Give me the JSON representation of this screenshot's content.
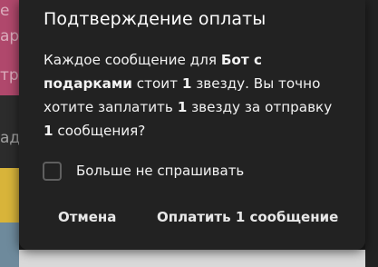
{
  "background": {
    "fragments": [
      "е",
      "ар",
      "тр",
      "аде"
    ],
    "colors": {
      "tile_pink": "#b0486c",
      "tile_yellow": "#d8b43a",
      "tile_dark": "#2c2c2c"
    }
  },
  "dialog": {
    "title": "Подтверждение оплаты",
    "body": {
      "part1": "Каждое сообщение для ",
      "bot_name": "Бот с подарками",
      "part2": " стоит ",
      "cost_amount": "1",
      "part3": " звезду. Вы точно хотите заплатить ",
      "pay_amount": "1",
      "part4": " звезду за отправку ",
      "message_count": "1",
      "part5": " сообщения?"
    },
    "checkbox": {
      "label": "Больше не спрашивать",
      "checked": false
    },
    "buttons": {
      "cancel_label": "Отмена",
      "pay_label": "Оплатить 1 сообщение"
    },
    "colors": {
      "background": "#222222",
      "text": "#ffffff"
    }
  }
}
